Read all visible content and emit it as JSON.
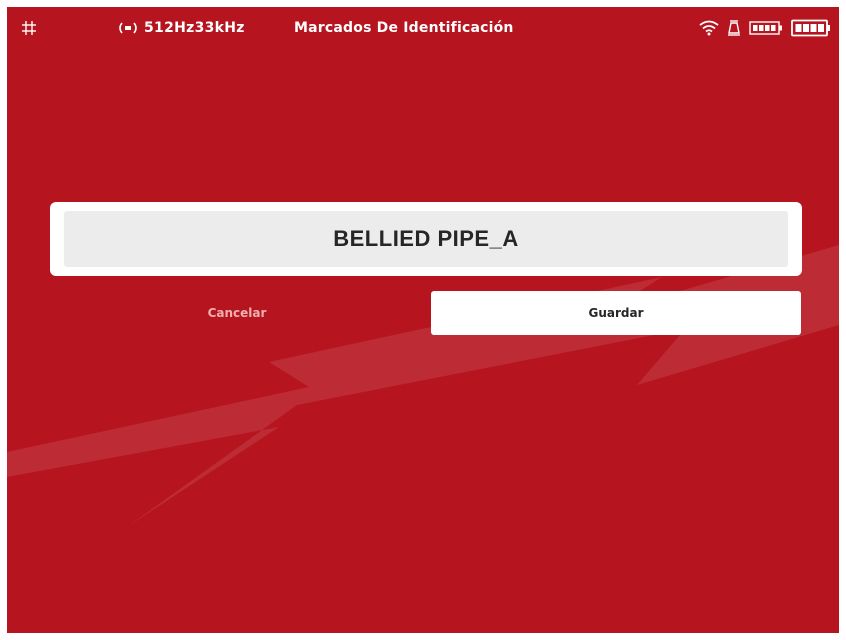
{
  "status_bar": {
    "frequency": "512Hz33kHz",
    "title": "Marcados De Identificación",
    "icons": [
      "grid-icon",
      "signal-icon",
      "wifi-icon",
      "lamp-icon",
      "battery-small-icon",
      "battery-main-icon"
    ]
  },
  "name_field": {
    "value": "BELLIED PIPE_A"
  },
  "actions": {
    "cancel_label": "Cancelar",
    "save_label": "Guardar"
  },
  "colors": {
    "background": "#b6141e",
    "accent_white": "#ffffff",
    "field_gray": "#ececec"
  }
}
